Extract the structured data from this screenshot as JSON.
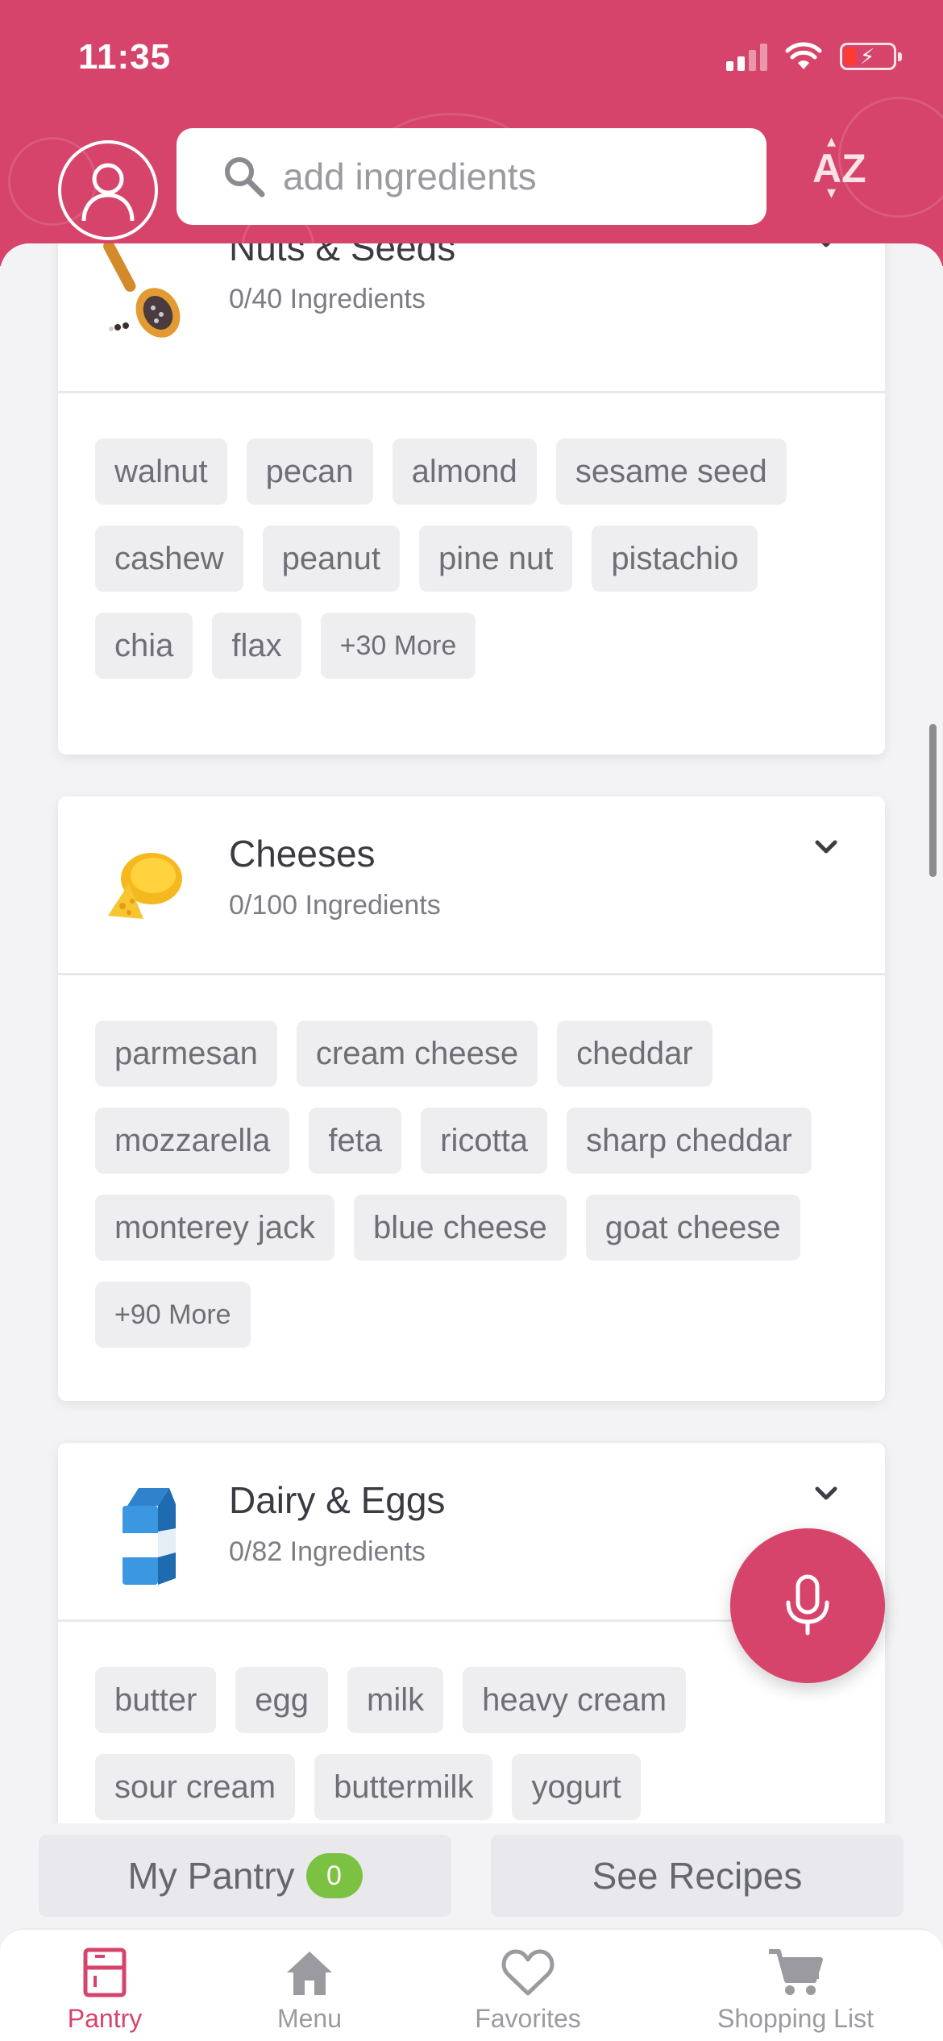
{
  "status_bar": {
    "time": "11:35"
  },
  "header": {
    "search": {
      "placeholder": "add ingredients"
    },
    "sort_label": "AZ"
  },
  "categories": [
    {
      "title": "Nuts & Seeds",
      "count": "0/40 Ingredients",
      "icon": "wooden-spoon-seeds",
      "chips": [
        "walnut",
        "pecan",
        "almond",
        "sesame seed",
        "cashew",
        "peanut",
        "pine nut",
        "pistachio",
        "chia",
        "flax"
      ],
      "more": "+30 More"
    },
    {
      "title": "Cheeses",
      "count": "0/100 Ingredients",
      "icon": "cheese-wedge",
      "chips": [
        "parmesan",
        "cream cheese",
        "cheddar",
        "mozzarella",
        "feta",
        "ricotta",
        "sharp cheddar",
        "monterey jack",
        "blue cheese",
        "goat cheese"
      ],
      "more": "+90 More"
    },
    {
      "title": "Dairy & Eggs",
      "count": "0/82 Ingredients",
      "icon": "milk-carton",
      "chips": [
        "butter",
        "egg",
        "milk",
        "heavy cream",
        "sour cream",
        "buttermilk",
        "yogurt"
      ]
    }
  ],
  "actions": {
    "my_pantry": "My Pantry",
    "pantry_count": "0",
    "see_recipes": "See Recipes"
  },
  "tabs": [
    {
      "label": "Pantry",
      "icon": "pantry-icon",
      "active": true
    },
    {
      "label": "Menu",
      "icon": "home-icon",
      "active": false
    },
    {
      "label": "Favorites",
      "icon": "heart-icon",
      "active": false
    },
    {
      "label": "Shopping List",
      "icon": "cart-icon",
      "active": false
    }
  ],
  "colors": {
    "brand": "#d6446b",
    "badge": "#7cc242",
    "chip_bg": "#eeeef1"
  }
}
